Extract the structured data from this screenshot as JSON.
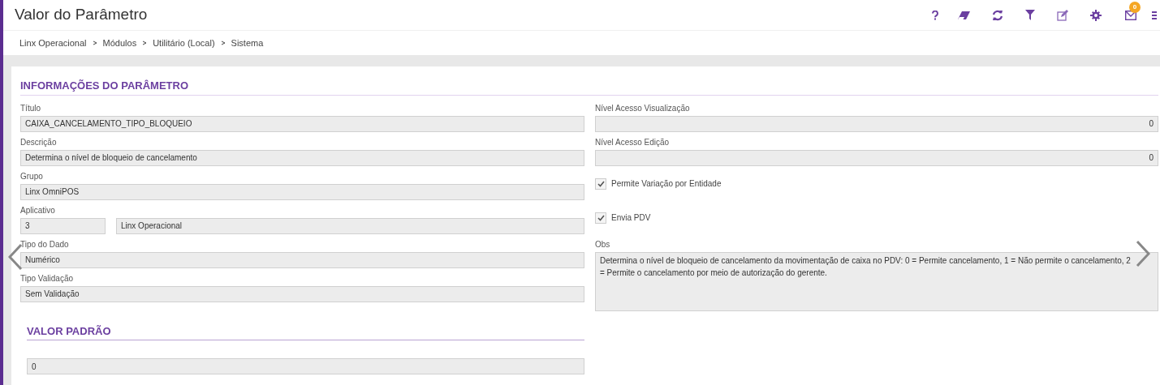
{
  "header": {
    "title": "Valor do Parâmetro",
    "toolbar": [
      {
        "kind": "help"
      },
      {
        "kind": "eraser"
      },
      {
        "kind": "refresh"
      },
      {
        "kind": "filter"
      },
      {
        "kind": "edit"
      },
      {
        "kind": "settings"
      },
      {
        "kind": "mail",
        "badge": "0"
      },
      {
        "kind": "menu"
      }
    ]
  },
  "breadcrumb": [
    "Linx Operacional",
    "Módulos",
    "Utilitário (Local)",
    "Sistema"
  ],
  "section": {
    "title": "INFORMAÇÕES DO PARÂMETRO",
    "left": [
      {
        "kind": "text",
        "label": "Título",
        "value": "CAIXA_CANCELAMENTO_TIPO_BLOQUEIO"
      },
      {
        "kind": "text",
        "label": "Descrição",
        "value": "Determina o nível de bloqueio de cancelamento"
      },
      {
        "kind": "text",
        "label": "Grupo",
        "value": "Linx OmniPOS"
      },
      {
        "kind": "pair",
        "label": "Aplicativo",
        "value": "3",
        "value_2": "Linx Operacional"
      },
      {
        "kind": "text",
        "label": "Tipo do Dado",
        "value": "Numérico"
      },
      {
        "kind": "text",
        "label": "Tipo Validação",
        "value": "Sem Validação"
      }
    ],
    "right": [
      {
        "kind": "number",
        "label": "Nível Acesso Visualização",
        "value": "0"
      },
      {
        "kind": "number",
        "label": "Nível Acesso Edição",
        "value": "0"
      },
      {
        "kind": "checkbox",
        "label": "Permite Variação por Entidade",
        "checked": true
      },
      {
        "kind": "checkbox",
        "label": "Envia PDV",
        "checked": true
      },
      {
        "kind": "textarea",
        "label": "Obs",
        "value": "Determina o nível de bloqueio de cancelamento da movimentação de caixa no PDV: 0 = Permite cancelamento, 1 = Não permite o cancelamento, 2 = Permite o cancelamento por meio de autorização do gerente."
      }
    ]
  },
  "default_section": {
    "title": "VALOR PADRÃO",
    "value": "0"
  }
}
